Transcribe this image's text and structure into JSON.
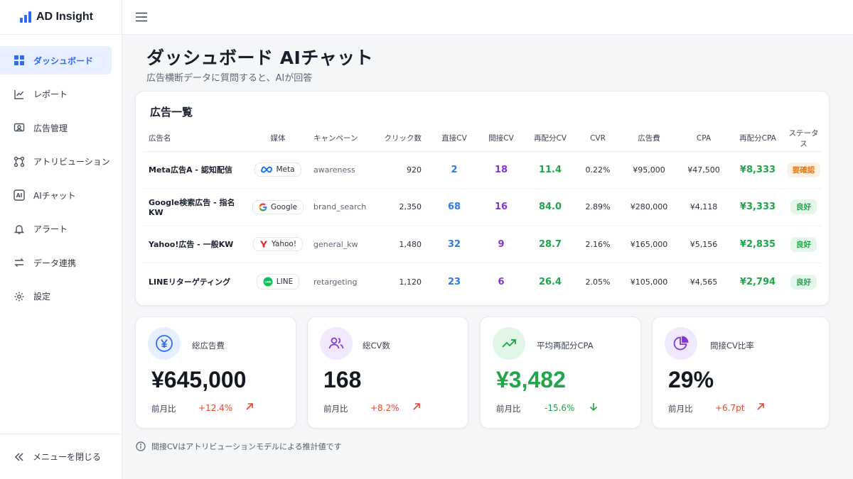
{
  "app": {
    "name": "AD Insight"
  },
  "sidebar": {
    "items": [
      {
        "label": "ダッシュボード",
        "icon": "grid-icon",
        "active": true
      },
      {
        "label": "レポート",
        "icon": "chart-icon"
      },
      {
        "label": "広告管理",
        "icon": "ad-manage-icon"
      },
      {
        "label": "アトリビューション",
        "icon": "attribution-icon"
      },
      {
        "label": "AIチャット",
        "icon": "ai-icon"
      },
      {
        "label": "アラート",
        "icon": "bell-icon"
      },
      {
        "label": "データ連携",
        "icon": "sync-icon"
      },
      {
        "label": "設定",
        "icon": "gear-icon"
      }
    ],
    "collapse_label": "メニューを閉じる"
  },
  "page": {
    "title": "ダッシュボード AIチャット",
    "subtitle": "広告横断データに質問すると、AIが回答"
  },
  "ads_table": {
    "title": "広告一覧",
    "columns": [
      "広告名",
      "媒体",
      "キャンペーン",
      "クリック数",
      "直接CV",
      "間接CV",
      "再配分CV",
      "CVR",
      "広告費",
      "CPA",
      "再配分CPA",
      "ステータス"
    ],
    "rows": [
      {
        "name": "Meta広告A - 認知配信",
        "media": "Meta",
        "campaign": "awareness",
        "clicks": "920",
        "direct_cv": "2",
        "indirect_cv": "18",
        "realloc_cv": "11.4",
        "cvr": "0.22%",
        "spend": "¥95,000",
        "cpa": "¥47,500",
        "realloc_cpa": "¥8,333",
        "status": "要確認",
        "status_type": "warn"
      },
      {
        "name": "Google検索広告 - 指名KW",
        "media": "Google",
        "campaign": "brand_search",
        "clicks": "2,350",
        "direct_cv": "68",
        "indirect_cv": "16",
        "realloc_cv": "84.0",
        "cvr": "2.89%",
        "spend": "¥280,000",
        "cpa": "¥4,118",
        "realloc_cpa": "¥3,333",
        "status": "良好",
        "status_type": "ok"
      },
      {
        "name": "Yahoo!広告 - 一般KW",
        "media": "Yahoo!",
        "campaign": "general_kw",
        "clicks": "1,480",
        "direct_cv": "32",
        "indirect_cv": "9",
        "realloc_cv": "28.7",
        "cvr": "2.16%",
        "spend": "¥165,000",
        "cpa": "¥5,156",
        "realloc_cpa": "¥2,835",
        "status": "良好",
        "status_type": "ok"
      },
      {
        "name": "LINEリターゲティング",
        "media": "LINE",
        "campaign": "retargeting",
        "clicks": "1,120",
        "direct_cv": "23",
        "indirect_cv": "6",
        "realloc_cv": "26.4",
        "cvr": "2.05%",
        "spend": "¥105,000",
        "cpa": "¥4,565",
        "realloc_cpa": "¥2,794",
        "status": "良好",
        "status_type": "ok"
      }
    ]
  },
  "kpis": [
    {
      "label": "総広告費",
      "value": "¥645,000",
      "compare_label": "前月比",
      "delta": "+12.4%",
      "trend": "up",
      "icon": "yen-icon"
    },
    {
      "label": "総CV数",
      "value": "168",
      "compare_label": "前月比",
      "delta": "+8.2%",
      "trend": "up",
      "icon": "users-icon"
    },
    {
      "label": "平均再配分CPA",
      "value": "¥3,482",
      "compare_label": "前月比",
      "delta": "-15.6%",
      "trend": "down",
      "icon": "trend-up-icon"
    },
    {
      "label": "間接CV比率",
      "value": "29%",
      "compare_label": "前月比",
      "delta": "+6.7pt",
      "trend": "up",
      "icon": "pie-icon"
    }
  ],
  "footnote": "間接CVはアトリビューションモデルによる推計値です",
  "colors": {
    "accent": "#2f6bf2",
    "direct_cv": "#2f7be8",
    "indirect_cv": "#8236d6",
    "realloc": "#1fa64a",
    "up_delta": "#e8452c",
    "down_delta": "#1fa64a"
  }
}
